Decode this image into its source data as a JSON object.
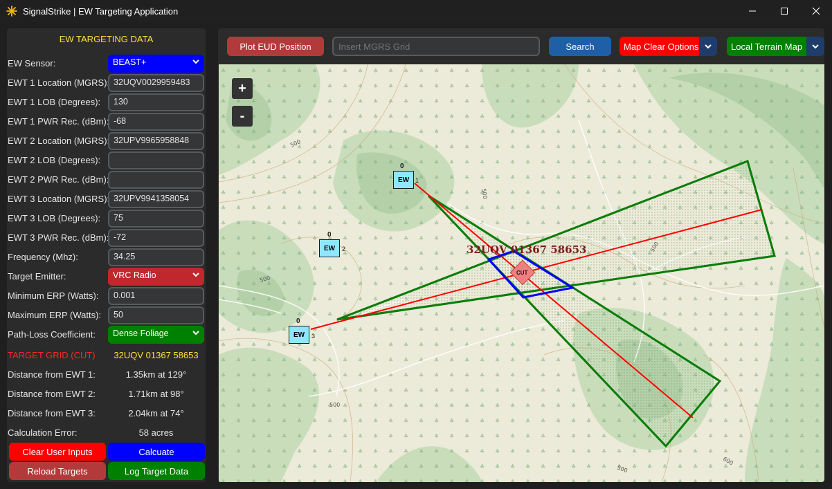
{
  "window": {
    "title": "SignalStrike | EW Targeting Application"
  },
  "left_panel": {
    "header": "EW TARGETING DATA",
    "fields": [
      {
        "label": "EW Sensor:",
        "value": "BEAST+",
        "type": "select",
        "color": "#0000ff"
      },
      {
        "label": "EWT 1 Location (MGRS):",
        "value": "32UQV0029959483",
        "type": "entry"
      },
      {
        "label": "EWT 1 LOB (Degrees):",
        "value": "130",
        "type": "entry"
      },
      {
        "label": "EWT 1 PWR Rec. (dBm):",
        "value": "-68",
        "type": "entry"
      },
      {
        "label": "EWT 2 Location (MGRS):",
        "value": "32UPV9965958848",
        "type": "entry"
      },
      {
        "label": "EWT 2 LOB (Degrees):",
        "value": "",
        "type": "entry"
      },
      {
        "label": "EWT 2 PWR Rec. (dBm):",
        "value": "",
        "type": "entry"
      },
      {
        "label": "EWT 3 Location (MGRS):",
        "value": "32UPV9941358054",
        "type": "entry"
      },
      {
        "label": "EWT 3 LOB (Degrees):",
        "value": "75",
        "type": "entry"
      },
      {
        "label": "EWT 3 PWR Rec. (dBm):",
        "value": "-72",
        "type": "entry"
      },
      {
        "label": "Frequency (Mhz):",
        "value": "34.25",
        "type": "entry"
      },
      {
        "label": "Target Emitter:",
        "value": "VRC Radio",
        "type": "select",
        "color": "#c0282d"
      },
      {
        "label": "Minimum ERP (Watts):",
        "value": "0.001",
        "type": "entry"
      },
      {
        "label": "Maximum ERP (Watts):",
        "value": "50",
        "type": "entry"
      },
      {
        "label": "Path-Loss Coefficient:",
        "value": "Dense Foliage",
        "type": "select",
        "color": "#008000"
      }
    ],
    "results": [
      {
        "label": "TARGET GRID (CUT)",
        "value": "32UQV 01367 58653"
      },
      {
        "label": "Distance from EWT 1:",
        "value": "1.35km at 129°"
      },
      {
        "label": "Distance from EWT 2:",
        "value": "1.71km at 98°"
      },
      {
        "label": "Distance from EWT 3:",
        "value": "2.04km at 74°"
      },
      {
        "label": "Calculation Error:",
        "value": "58 acres"
      }
    ],
    "buttons": {
      "clear": "Clear User Inputs",
      "calculate": "Calcuate",
      "reload": "Reload Targets",
      "log": "Log Target Data"
    }
  },
  "toolbar": {
    "plot_eud": "Plot EUD Position",
    "mgrs_placeholder": "Insert MGRS Grid",
    "search": "Search",
    "map_clear": "Map Clear Options",
    "map_type": "Local Terrain Map"
  },
  "map": {
    "zoom_in": "+",
    "zoom_out": "-",
    "target_label": "32UQV 01367 58653",
    "cut_label": "CUT",
    "markers": [
      {
        "label": "EW",
        "number": "1",
        "zero": "0"
      },
      {
        "label": "EW",
        "number": "2",
        "zero": "0"
      },
      {
        "label": "EW",
        "number": "3",
        "zero": "0"
      }
    ],
    "contour_labels": [
      "500",
      "500",
      "500",
      "500",
      "500",
      "500",
      "600"
    ]
  },
  "colors": {
    "header_yellow": "#ffe135",
    "red_button": "#ff0000",
    "blue_button": "#0000ff",
    "dark_red_button": "#b33a3a",
    "green_button": "#008000",
    "lob_red": "#ff0000",
    "sector_green": "#0a7d0a",
    "cut_blue": "#0000ff"
  },
  "icons": {
    "app": "signal-star-icon",
    "dropdown": "chevron-down-icon"
  }
}
